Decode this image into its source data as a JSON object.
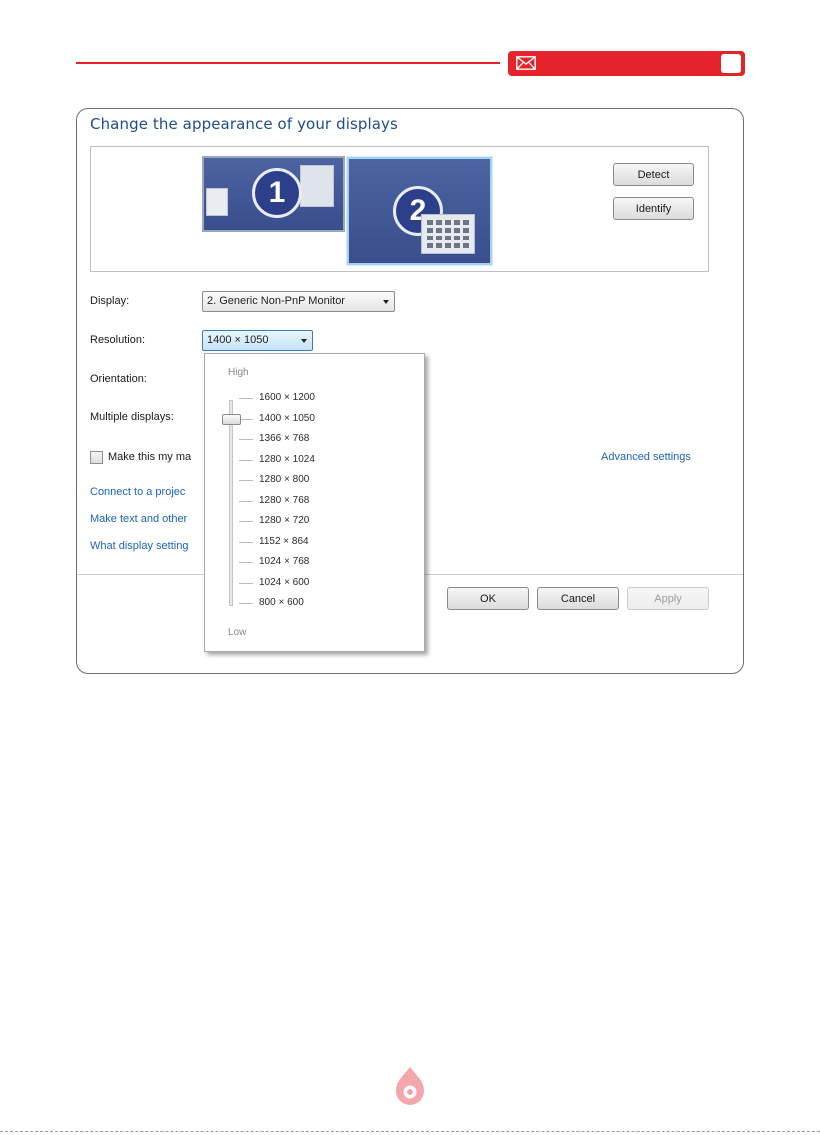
{
  "header": {
    "accent_color": "#e5232b",
    "icon": "envelope-icon"
  },
  "dialog": {
    "title": "Change the appearance of your displays",
    "monitors": [
      {
        "number": "1"
      },
      {
        "number": "2"
      }
    ],
    "detect_label": "Detect",
    "identify_label": "Identify",
    "display_label": "Display:",
    "display_value": "2. Generic Non-PnP Monitor",
    "resolution_label": "Resolution:",
    "resolution_value": "1400 × 1050",
    "orientation_label": "Orientation:",
    "multiple_displays_label": "Multiple displays:",
    "main_display_checkbox_label": "Make this my ma",
    "advanced_settings_link": "Advanced settings",
    "links": [
      "Connect to a projec",
      "Make text and other",
      "What display setting"
    ],
    "ok_label": "OK",
    "cancel_label": "Cancel",
    "apply_label": "Apply"
  },
  "resolution_dropdown": {
    "high_label": "High",
    "low_label": "Low",
    "selected_index": 1,
    "options": [
      "1600 × 1200",
      "1400 × 1050",
      "1366 × 768",
      "1280 × 1024",
      "1280 × 800",
      "1280 × 768",
      "1280 × 720",
      "1152 × 864",
      "1024 × 768",
      "1024 × 600",
      "800 × 600"
    ]
  }
}
